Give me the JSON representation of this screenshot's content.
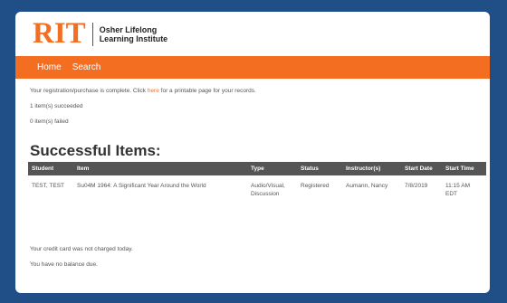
{
  "header": {
    "logo_text": "RIT",
    "institute_line1": "Osher Lifelong",
    "institute_line2": "Learning Institute"
  },
  "nav": {
    "items": [
      {
        "label": "Home"
      },
      {
        "label": "Search"
      }
    ]
  },
  "messages": {
    "complete_prefix": "Your registration/purchase is complete. Click ",
    "here_link": "here",
    "complete_suffix": " for a printable page for your records.",
    "succeeded": "1 item(s) succeeded",
    "failed": "0 item(s) failed"
  },
  "successful_items": {
    "heading": "Successful Items:",
    "columns": [
      "Student",
      "Item",
      "Type",
      "Status",
      "Instructor(s)",
      "Start Date",
      "Start Time"
    ],
    "rows": [
      {
        "student": "TEST, TEST",
        "item": "Su04M 1964: A Significant Year Around the World",
        "type": "Audio/Visual, Discussion",
        "status": "Registered",
        "instructor": "Aumann, Nancy",
        "start_date": "7/8/2019",
        "start_time": "11:15 AM EDT"
      }
    ]
  },
  "footer": {
    "credit_card": "Your credit card was not charged today.",
    "balance": "You have no balance due."
  },
  "colors": {
    "background": "#1f4f86",
    "accent": "#f36e21",
    "table_header": "#555555"
  }
}
